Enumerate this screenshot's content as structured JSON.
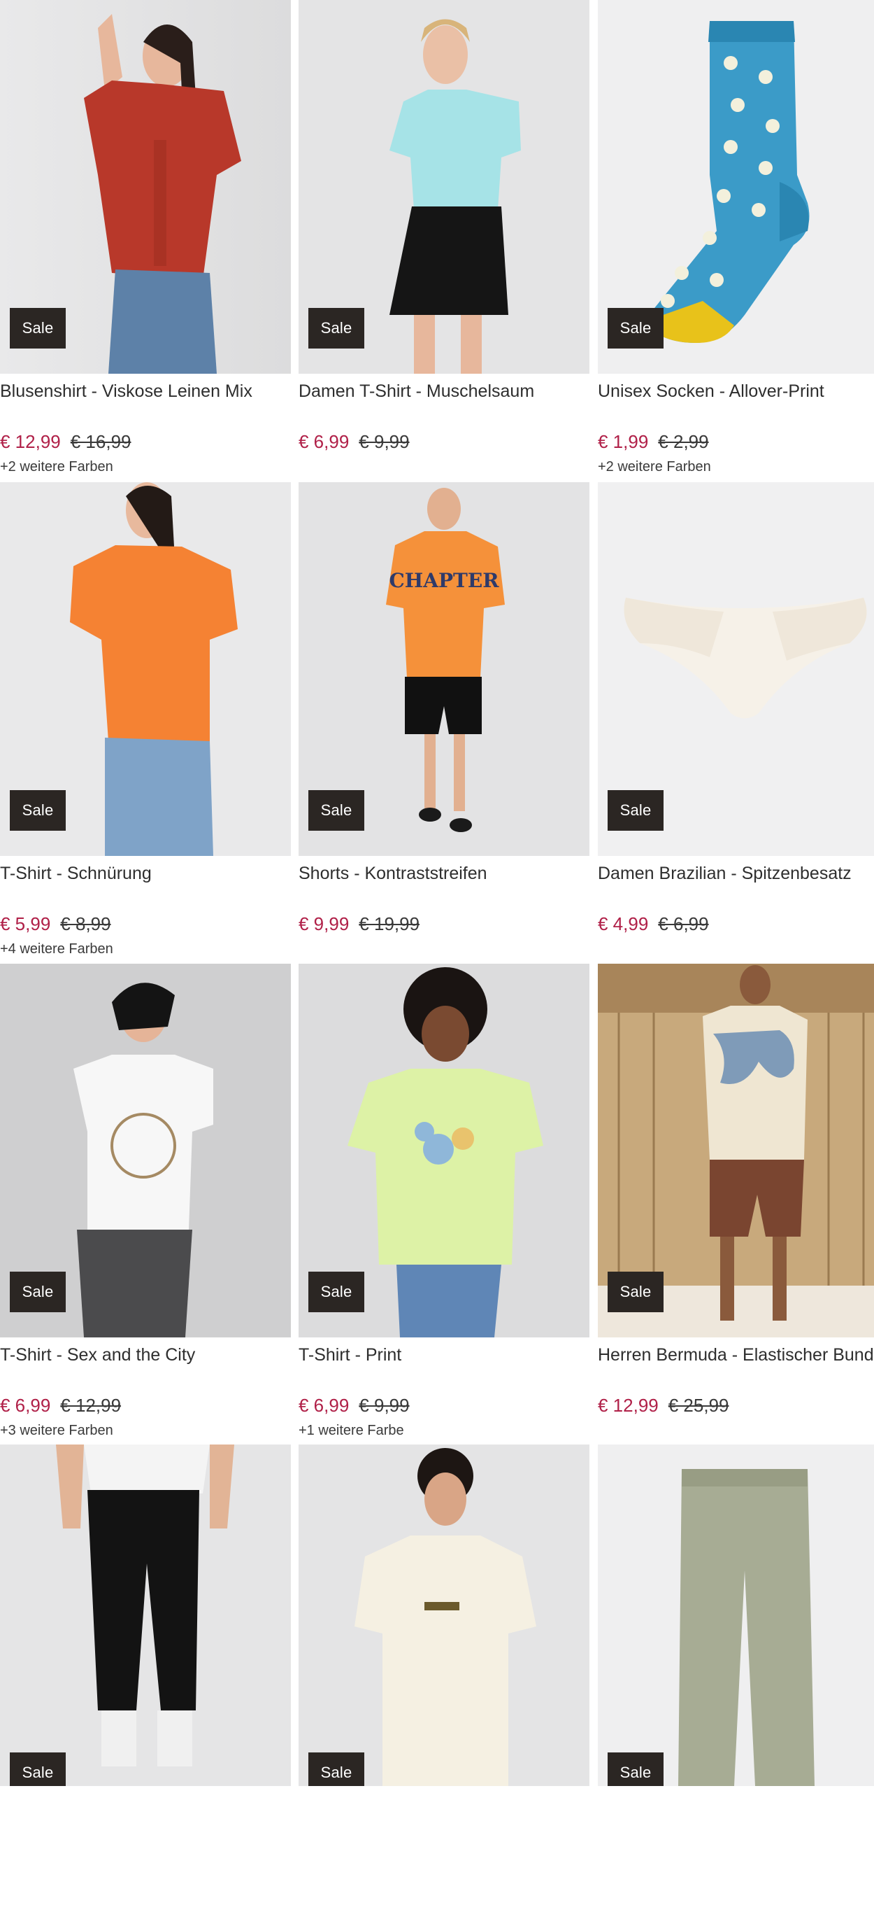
{
  "products": [
    {
      "title": "Blusenshirt - Viskose Leinen Mix",
      "badge": "Sale",
      "price_new": "€ 12,99",
      "price_old": "€ 16,99",
      "colors": "+2 weitere Farben",
      "image": "model-red-blouse-jeans"
    },
    {
      "title": "Damen T-Shirt - Muschelsaum",
      "badge": "Sale",
      "price_new": "€ 6,99",
      "price_old": "€ 9,99",
      "colors": "",
      "image": "model-mint-tshirt-black-shorts"
    },
    {
      "title": "Unisex Socken - Allover-Print",
      "badge": "Sale",
      "price_new": "€ 1,99",
      "price_old": "€ 2,99",
      "colors": "+2 weitere Farben",
      "image": "blue-daisy-sock"
    },
    {
      "title": "T-Shirt - Schnürung",
      "badge": "Sale",
      "price_new": "€ 5,99",
      "price_old": "€ 8,99",
      "colors": "+4 weitere Farben",
      "image": "model-orange-tshirt-jeans"
    },
    {
      "title": "Shorts - Kontraststreifen",
      "badge": "Sale",
      "price_new": "€ 9,99",
      "price_old": "€ 19,99",
      "colors": "",
      "image": "man-orange-tshirt-black-shorts"
    },
    {
      "title": "Damen Brazilian - Spitzenbesatz",
      "badge": "Sale",
      "price_new": "€ 4,99",
      "price_old": "€ 6,99",
      "colors": "",
      "image": "cream-brazilian-brief"
    },
    {
      "title": "T-Shirt - Sex and the City",
      "badge": "Sale",
      "price_new": "€ 6,99",
      "price_old": "€ 12,99",
      "colors": "+3 weitere Farben",
      "image": "model-white-print-tshirt"
    },
    {
      "title": "T-Shirt - Print",
      "badge": "Sale",
      "price_new": "€ 6,99",
      "price_old": "€ 9,99",
      "colors": "+1 weitere Farbe",
      "image": "model-lime-floral-tshirt"
    },
    {
      "title": "Herren Bermuda - Elastischer Bund",
      "badge": "Sale",
      "price_new": "€ 12,99",
      "price_old": "€ 25,99",
      "colors": "",
      "image": "man-floral-shirt-brown-bermuda"
    },
    {
      "title": "",
      "badge": "Sale",
      "price_new": "",
      "price_old": "",
      "colors": "",
      "image": "man-black-joggers"
    },
    {
      "title": "",
      "badge": "Sale",
      "price_new": "",
      "price_old": "",
      "colors": "",
      "image": "man-cream-tshirt"
    },
    {
      "title": "",
      "badge": "Sale",
      "price_new": "",
      "price_old": "",
      "colors": "",
      "image": "olive-leggings"
    }
  ],
  "colors": {
    "sale_badge_bg": "#2b2623",
    "price_new": "#b02048",
    "price_old": "#3a3a3a",
    "image_bg": "#e9e9ea"
  }
}
